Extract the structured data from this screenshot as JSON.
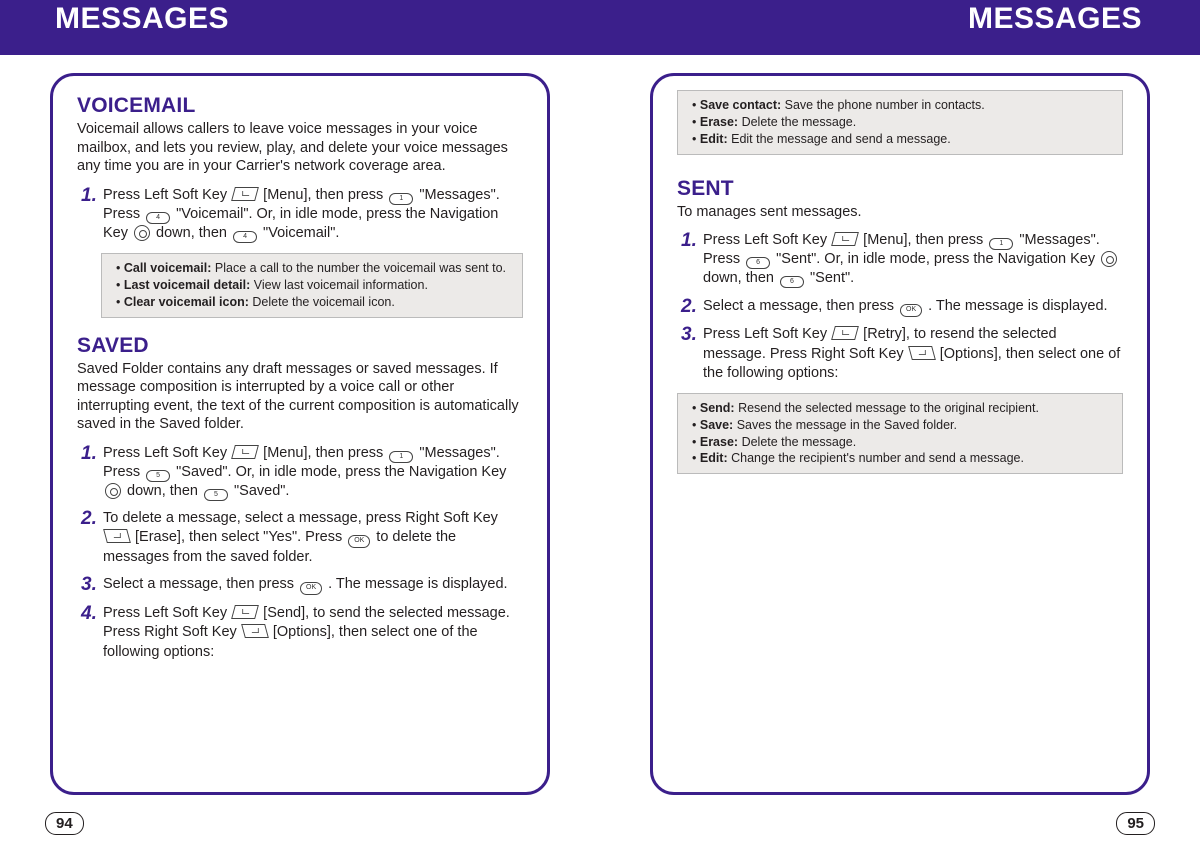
{
  "header": {
    "left": "MESSAGES",
    "right": "MESSAGES"
  },
  "page_left": {
    "number": "94",
    "voicemail": {
      "title": "VOICEMAIL",
      "desc": "Voicemail allows callers to leave voice messages in your voice mailbox, and lets you review, play, and delete your voice messages any time you are in your Carrier's network coverage area.",
      "step1_a": "Press Left Soft Key ",
      "step1_b": " [Menu], then press ",
      "step1_c": " \"Messages\". Press ",
      "step1_d": " \"Voicemail\". Or, in idle mode, press the Navigation Key ",
      "step1_e": " down, then ",
      "step1_f": " \"Voicemail\".",
      "opts": {
        "o1b": "Call voicemail: ",
        "o1": "Place a call to the number the voicemail was sent to.",
        "o2b": "Last voicemail detail: ",
        "o2": "View last voicemail information.",
        "o3b": "Clear voicemail icon: ",
        "o3": "Delete the voicemail icon."
      }
    },
    "saved": {
      "title": "SAVED",
      "desc": "Saved Folder contains any draft messages or saved messages. If message composition is interrupted by a voice call or other interrupting event, the text of the current composition is automatically saved in the Saved folder.",
      "s1_a": "Press Left Soft Key ",
      "s1_b": " [Menu], then press ",
      "s1_c": " \"Messages\". Press ",
      "s1_d": " \"Saved\". Or, in idle mode, press the Navigation Key ",
      "s1_e": " down, then ",
      "s1_f": " \"Saved\".",
      "s2_a": "To delete a message, select a message, press Right Soft Key ",
      "s2_b": " [Erase], then select \"Yes\". Press ",
      "s2_c": " to delete the messages from the saved folder.",
      "s3_a": "Select a message, then press ",
      "s3_b": " . The message is displayed.",
      "s4_a": "Press Left Soft Key ",
      "s4_b": " [Send], to send the selected message. Press Right Soft Key ",
      "s4_c": " [Options], then select one of the following options:"
    }
  },
  "page_right": {
    "number": "95",
    "cont_opts": {
      "o1b": "Save contact: ",
      "o1": "Save the phone number in contacts.",
      "o2b": "Erase: ",
      "o2": "Delete the message.",
      "o3b": "Edit: ",
      "o3": "Edit the message and send a message."
    },
    "sent": {
      "title": "SENT",
      "desc": "To manages sent messages.",
      "s1_a": "Press Left Soft Key ",
      "s1_b": " [Menu], then press ",
      "s1_c": " \"Messages\". Press ",
      "s1_d": " \"Sent\". Or, in idle mode, press the Navigation Key ",
      "s1_e": " down, then ",
      "s1_f": " \"Sent\".",
      "s2_a": "Select a message, then press ",
      "s2_b": " . The message is displayed.",
      "s3_a": "Press Left Soft Key ",
      "s3_b": " [Retry], to resend the selected message. Press Right Soft Key ",
      "s3_c": " [Options], then select one of the following options:",
      "opts": {
        "o1b": "Send: ",
        "o1": "Resend the selected message to the original recipient.",
        "o2b": "Save: ",
        "o2": "Saves the message in the Saved folder.",
        "o3b": "Erase: ",
        "o3": "Delete the message.",
        "o4b": "Edit: ",
        "o4": "Change the recipient's number and send a message."
      }
    }
  },
  "nums": {
    "n1": "1.",
    "n2": "2.",
    "n3": "3.",
    "n4": "4."
  },
  "keys": {
    "one": "1",
    "four": "4",
    "five": "5",
    "six": "6",
    "ok": "OK"
  }
}
